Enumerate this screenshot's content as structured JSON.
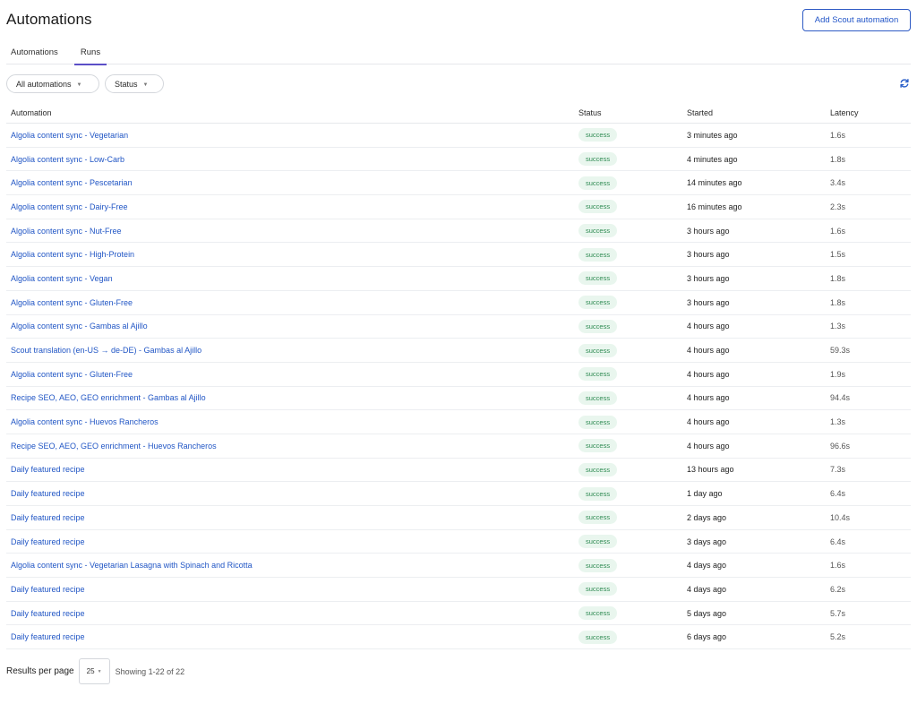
{
  "header": {
    "title": "Automations",
    "add_button_label": "Add Scout automation"
  },
  "tabs": [
    {
      "label": "Automations"
    },
    {
      "label": "Runs",
      "active": true
    }
  ],
  "filters": {
    "automation_filter": {
      "label": "All automations",
      "icon": "chevron-down-icon"
    },
    "status_filter": {
      "label": "Status",
      "icon": "chevron-down-icon"
    },
    "refresh_icon": "refresh-icon"
  },
  "table": {
    "columns": [
      "Automation",
      "Status",
      "Started",
      "Latency"
    ],
    "rows": [
      {
        "automation": "Algolia content sync - Vegetarian",
        "status": "success",
        "started": "3 minutes ago",
        "latency": "1.6s"
      },
      {
        "automation": "Algolia content sync - Low-Carb",
        "status": "success",
        "started": "4 minutes ago",
        "latency": "1.8s"
      },
      {
        "automation": "Algolia content sync - Pescetarian",
        "status": "success",
        "started": "14 minutes ago",
        "latency": "3.4s"
      },
      {
        "automation": "Algolia content sync - Dairy-Free",
        "status": "success",
        "started": "16 minutes ago",
        "latency": "2.3s"
      },
      {
        "automation": "Algolia content sync - Nut-Free",
        "status": "success",
        "started": "3 hours ago",
        "latency": "1.6s"
      },
      {
        "automation": "Algolia content sync - High-Protein",
        "status": "success",
        "started": "3 hours ago",
        "latency": "1.5s"
      },
      {
        "automation": "Algolia content sync - Vegan",
        "status": "success",
        "started": "3 hours ago",
        "latency": "1.8s"
      },
      {
        "automation": "Algolia content sync - Gluten-Free",
        "status": "success",
        "started": "3 hours ago",
        "latency": "1.8s"
      },
      {
        "automation": "Algolia content sync - Gambas al Ajillo",
        "status": "success",
        "started": "4 hours ago",
        "latency": "1.3s"
      },
      {
        "automation": "Scout translation (en-US → de-DE) - Gambas al Ajillo",
        "status": "success",
        "started": "4 hours ago",
        "latency": "59.3s"
      },
      {
        "automation": "Algolia content sync - Gluten-Free",
        "status": "success",
        "started": "4 hours ago",
        "latency": "1.9s"
      },
      {
        "automation": "Recipe SEO, AEO, GEO enrichment - Gambas al Ajillo",
        "status": "success",
        "started": "4 hours ago",
        "latency": "94.4s"
      },
      {
        "automation": "Algolia content sync - Huevos Rancheros",
        "status": "success",
        "started": "4 hours ago",
        "latency": "1.3s"
      },
      {
        "automation": "Recipe SEO, AEO, GEO enrichment - Huevos Rancheros",
        "status": "success",
        "started": "4 hours ago",
        "latency": "96.6s"
      },
      {
        "automation": "Daily featured recipe",
        "status": "success",
        "started": "13 hours ago",
        "latency": "7.3s"
      },
      {
        "automation": "Daily featured recipe",
        "status": "success",
        "started": "1 day ago",
        "latency": "6.4s"
      },
      {
        "automation": "Daily featured recipe",
        "status": "success",
        "started": "2 days ago",
        "latency": "10.4s"
      },
      {
        "automation": "Daily featured recipe",
        "status": "success",
        "started": "3 days ago",
        "latency": "6.4s"
      },
      {
        "automation": "Algolia content sync - Vegetarian Lasagna with Spinach and Ricotta",
        "status": "success",
        "started": "4 days ago",
        "latency": "1.6s"
      },
      {
        "automation": "Daily featured recipe",
        "status": "success",
        "started": "4 days ago",
        "latency": "6.2s"
      },
      {
        "automation": "Daily featured recipe",
        "status": "success",
        "started": "5 days ago",
        "latency": "5.7s"
      },
      {
        "automation": "Daily featured recipe",
        "status": "success",
        "started": "6 days ago",
        "latency": "5.2s"
      }
    ]
  },
  "footer": {
    "results_per_page_label": "Results per page",
    "per_page_value": "25",
    "showing_text": "Showing 1-22 of 22"
  },
  "colors": {
    "link": "#2156c5",
    "accent": "#5b4fc7",
    "success_bg": "#e9f6ee",
    "success_text": "#2e8a52"
  }
}
